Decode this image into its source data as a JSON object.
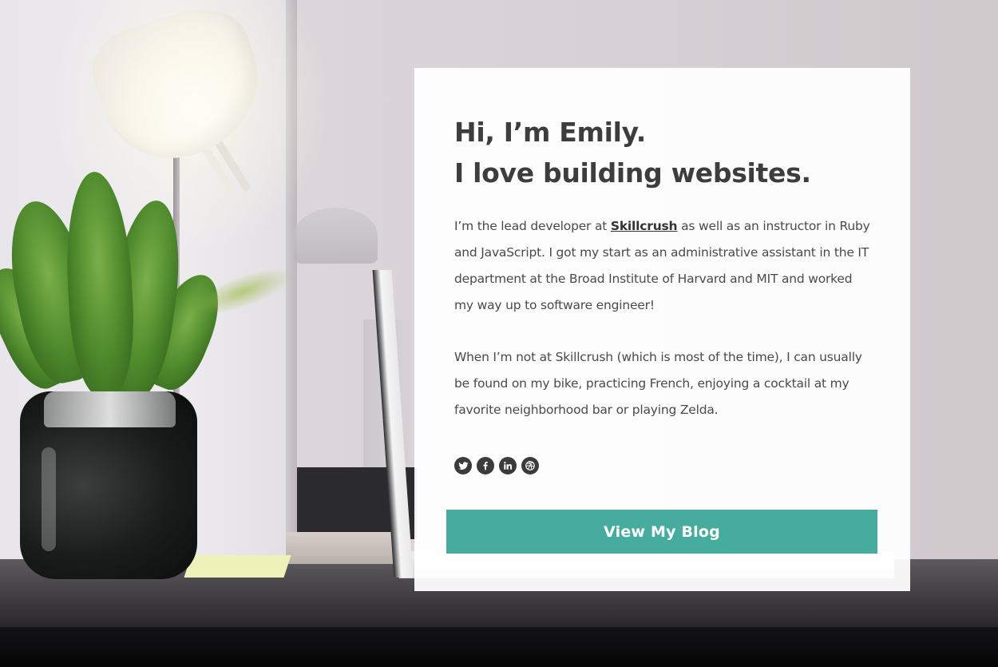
{
  "intro": {
    "headline_line1": "Hi, I’m Emily.",
    "headline_line2": "I love building websites."
  },
  "bio": {
    "p1_before": "I’m the lead developer at ",
    "p1_link": "Skillcrush",
    "p1_after": " as well as an instructor in Ruby and JavaScript. I got my start as an administrative assistant in the IT department at the Broad Institute of Harvard and MIT and worked my way up to software engineer!",
    "p2": "When I’m not at Skillcrush (which is most of the time), I can usually be found on my bike, practicing French, enjoying a cocktail at my favorite neighborhood bar or playing Zelda."
  },
  "social": {
    "icons": [
      "twitter-icon",
      "facebook-icon",
      "linkedin-icon",
      "dribbble-icon"
    ],
    "icon_color": "#3b3b3b"
  },
  "cta": {
    "label": "View My Blog",
    "color": "#46ad9e"
  }
}
